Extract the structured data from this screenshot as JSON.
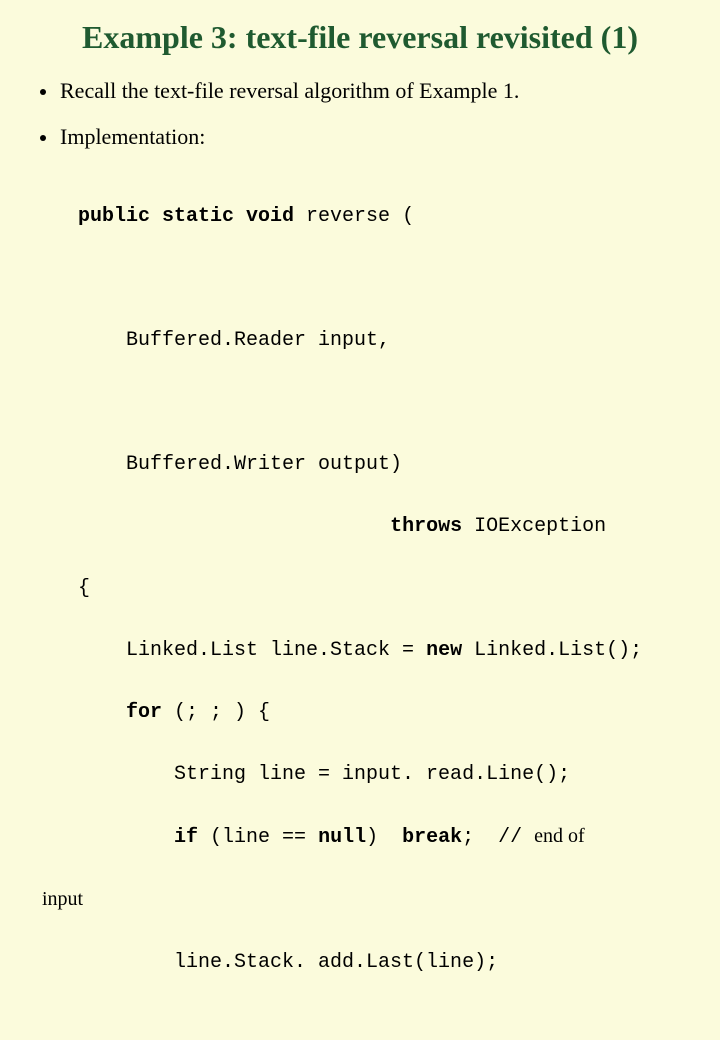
{
  "title": "Example 3: text-file reversal revisited (1)",
  "bullet1": "Recall the text-file reversal algorithm of Example 1.",
  "bullet2": "Implementation:",
  "code": {
    "l1a": "public static void",
    "l1b": " reverse (",
    "l2": "    Buffered.Reader input,",
    "l3": "    Buffered.Writer output)",
    "l4a": "                          ",
    "l4b": "throws",
    "l4c": " IOException",
    "l5": "{",
    "l6a": "    Linked.List line.Stack = ",
    "l6b": "new",
    "l6c": " Linked.List();",
    "l7a": "    ",
    "l7b": "for",
    "l7c": " (; ; ) {",
    "l8": "        String line = input. read.Line();",
    "l9a": "        ",
    "l9b": "if",
    "l9c": " (line == ",
    "l9d": "null",
    "l9e": ")  ",
    "l9f": "break",
    "l9g": ";  ",
    "l9h": "// ",
    "l9i": "end of",
    "inputlabel": "input",
    "l10": "        line.Stack. add.Last(line);"
  }
}
